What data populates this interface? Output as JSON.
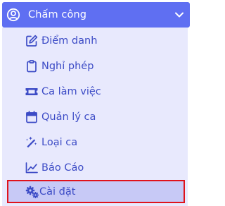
{
  "menu": {
    "header": {
      "label": "Chấm công",
      "icon": "user-circle-icon",
      "chevron": "chevron-down-icon",
      "color": "#5f6ff2"
    },
    "items": [
      {
        "label": "Điểm danh",
        "icon": "edit-icon"
      },
      {
        "label": "Nghỉ phép",
        "icon": "clipboard-icon"
      },
      {
        "label": "Ca làm việc",
        "icon": "ticket-icon"
      },
      {
        "label": "Quản lý ca",
        "icon": "calendar-icon"
      },
      {
        "label": "Loại ca",
        "icon": "magic-wand-icon"
      },
      {
        "label": "Báo Cáo",
        "icon": "line-chart-icon"
      },
      {
        "label": "Cài đặt",
        "icon": "gears-icon",
        "active": true
      }
    ],
    "colors": {
      "item_text": "#3d4cc6",
      "submenu_bg": "#e8e9fd",
      "active_bg": "#c7c9f6",
      "highlight_border": "#e0121b"
    }
  }
}
